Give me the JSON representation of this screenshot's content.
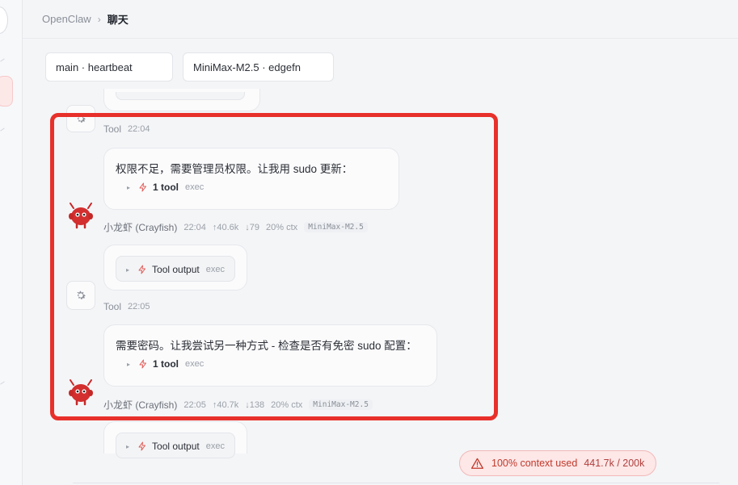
{
  "breadcrumb": {
    "root": "OpenClaw",
    "separator": "›",
    "current": "聊天"
  },
  "sessions": [
    {
      "label": "main · heartbeat"
    },
    {
      "label": "MiniMax-M2.5 · edgefn"
    }
  ],
  "messages": [
    {
      "type": "tool",
      "name": "Tool",
      "time": "22:04"
    },
    {
      "type": "assistant",
      "text": "权限不足，需要管理员权限。让我用 sudo 更新：",
      "tool_summary": {
        "label": "1 tool",
        "sub": "exec"
      },
      "meta": {
        "name": "小龙虾 (Crayfish)",
        "time": "22:04",
        "tokens_in": "↑40.6k",
        "tokens_out": "↓79",
        "ctx": "20% ctx",
        "model": "MiniMax-M2.5"
      }
    },
    {
      "type": "tool",
      "name": "Tool",
      "time": "22:05",
      "output": {
        "label": "Tool output",
        "sub": "exec"
      }
    },
    {
      "type": "assistant",
      "text": "需要密码。让我尝试另一种方式 - 检查是否有免密 sudo 配置：",
      "tool_summary": {
        "label": "1 tool",
        "sub": "exec"
      },
      "meta": {
        "name": "小龙虾 (Crayfish)",
        "time": "22:05",
        "tokens_in": "↑40.7k",
        "tokens_out": "↓138",
        "ctx": "20% ctx",
        "model": "MiniMax-M2.5"
      }
    },
    {
      "type": "tool",
      "output": {
        "label": "Tool output",
        "sub": "exec"
      }
    }
  ],
  "context_warning": {
    "label": "100% context used",
    "value": "441.7k / 200k"
  },
  "colors": {
    "accent": "#e8302b",
    "warning_bg": "#fde7e7",
    "warning_text": "#c0392b"
  },
  "icons": {
    "tool": "gear-icon",
    "tool_call": "bolt-icon",
    "avatar": "crayfish-avatar",
    "warning": "warning-triangle-icon"
  }
}
